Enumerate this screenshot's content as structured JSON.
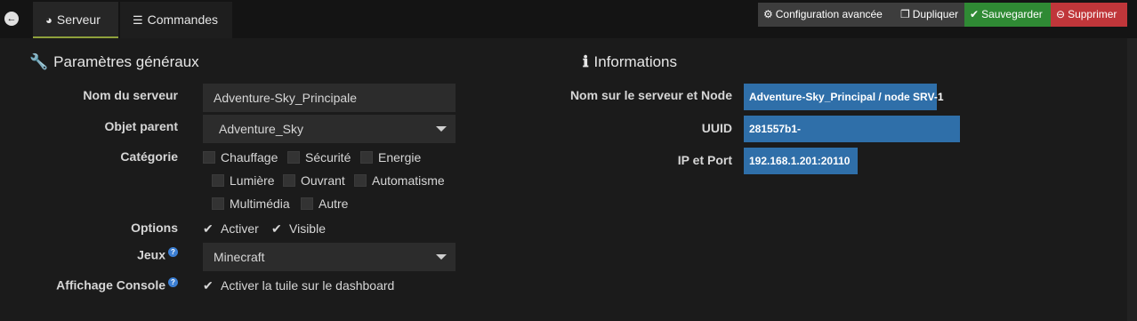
{
  "tabs": [
    {
      "label": "Serveur",
      "icon": "dashboard-icon"
    },
    {
      "label": "Commandes",
      "icon": "list-icon"
    }
  ],
  "actions": {
    "config": "Configuration avancée",
    "duplicate": "Dupliquer",
    "save": "Sauvegarder",
    "delete": "Supprimer"
  },
  "general": {
    "title": "Paramètres généraux",
    "server_name_label": "Nom du serveur",
    "server_name_value": "Adventure-Sky_Principale",
    "parent_label": "Objet parent",
    "parent_value": "Adventure_Sky",
    "category_label": "Catégorie",
    "categories": [
      "Chauffage",
      "Sécurité",
      "Energie",
      "Lumière",
      "Ouvrant",
      "Automatisme",
      "Multimédia",
      "Autre"
    ],
    "options_label": "Options",
    "option_enable": "Activer",
    "option_visible": "Visible",
    "game_label": "Jeux",
    "game_value": "Minecraft",
    "console_label": "Affichage Console",
    "console_option": "Activer la tuile sur le dashboard"
  },
  "info": {
    "title": "Informations",
    "node_label": "Nom sur le serveur et Node",
    "node_value": "Adventure-Sky_Principal / node SRV-1",
    "uuid_label": "UUID",
    "uuid_value": "281557b1-",
    "ipport_label": "IP et Port",
    "ipport_value": "192.168.1.201:20110"
  },
  "colors": {
    "accent_green": "#2f8a34",
    "accent_red": "#c0363a",
    "info_blue": "#2f6fa9",
    "tab_underline": "#8fa13c"
  }
}
